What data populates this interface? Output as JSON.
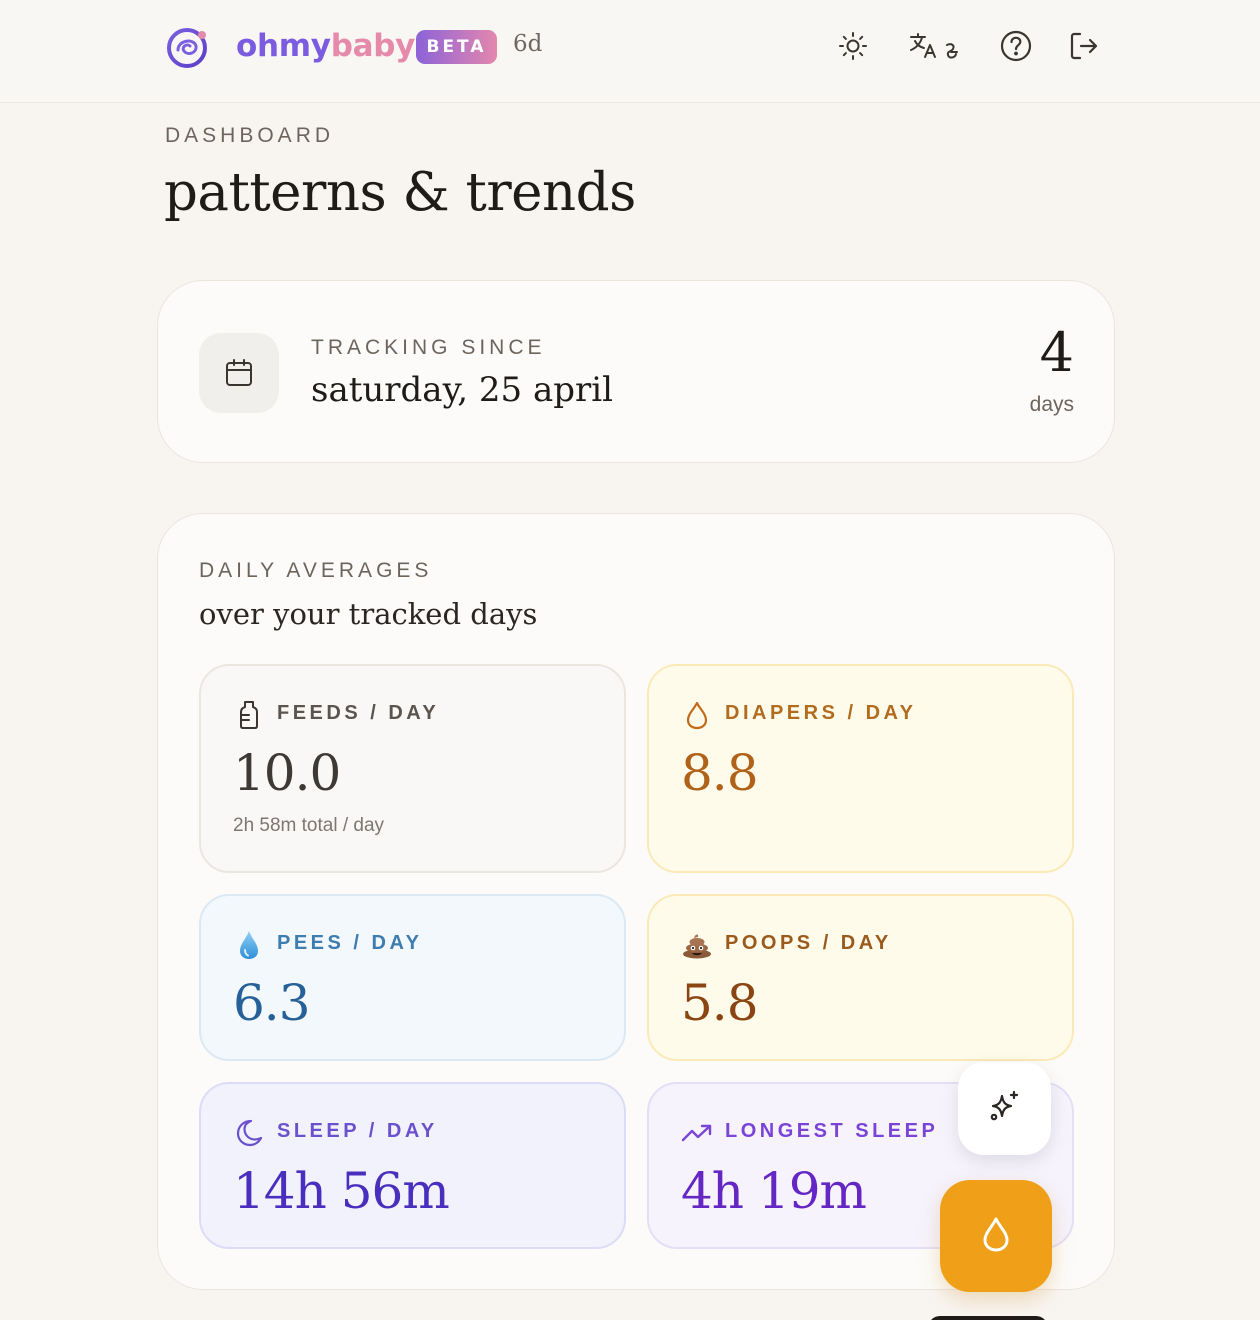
{
  "header": {
    "brand_part1": "ohmy",
    "brand_part2": "baby",
    "badge": "BETA",
    "age": "6d",
    "icons": [
      "logo-icon",
      "sun-icon",
      "translate-icon",
      "help-icon",
      "logout-icon"
    ]
  },
  "page": {
    "eyebrow": "DASHBOARD",
    "title": "patterns & trends"
  },
  "tracking": {
    "label": "TRACKING SINCE",
    "date": "saturday, 25 april",
    "count": "4",
    "unit": "days",
    "icon": "calendar-icon"
  },
  "averages": {
    "label": "DAILY AVERAGES",
    "subtitle": "over your tracked days",
    "tiles": {
      "feeds": {
        "label": "FEEDS / DAY",
        "value": "10.0",
        "note": "2h 58m total / day",
        "icon": "bottle-icon"
      },
      "diapers": {
        "label": "DIAPERS / DAY",
        "value": "8.8",
        "icon": "drop-outline-icon"
      },
      "pees": {
        "label": "PEES / DAY",
        "value": "6.3",
        "icon": "water-drop-icon"
      },
      "poops": {
        "label": "POOPS / DAY",
        "value": "5.8",
        "icon": "poop-emoji-icon"
      },
      "sleep": {
        "label": "SLEEP / DAY",
        "value": "14h 56m",
        "icon": "moon-icon"
      },
      "longest": {
        "label": "LONGEST SLEEP",
        "value": "4h 19m",
        "icon": "trend-up-icon"
      }
    }
  },
  "fabs": {
    "sparkle": "sparkle-icon",
    "drop": "drop-icon"
  },
  "colors": {
    "background": "#f8f5f1",
    "brand_purple": "#7b5ce0",
    "brand_pink": "#e58aaa",
    "fab_orange": "#efa018"
  }
}
